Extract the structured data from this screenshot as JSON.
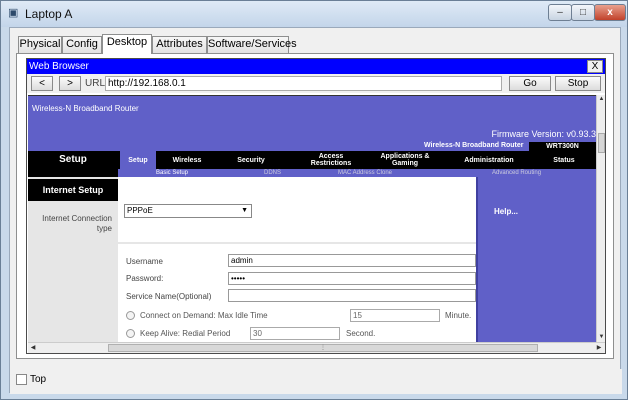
{
  "window": {
    "title": "Laptop A",
    "min_glyph": "–",
    "max_glyph": "□",
    "close_glyph": "x"
  },
  "tabs": [
    "Physical",
    "Config",
    "Desktop",
    "Attributes",
    "Software/Services"
  ],
  "active_tab": "Desktop",
  "browser": {
    "title": "Web Browser",
    "close_label": "X",
    "back_label": "<",
    "forward_label": ">",
    "url_label": "URL",
    "url_value": "http://192.168.0.1",
    "go_label": "Go",
    "stop_label": "Stop"
  },
  "router_page": {
    "banner_title": "Wireless-N Broadband Router",
    "firmware": "Firmware Version: v0.93.3",
    "product_name": "Wireless-N Broadband Router",
    "model": "WRT300N",
    "section_title": "Setup",
    "menu": [
      {
        "label": "Setup",
        "active": true
      },
      {
        "label": "Wireless",
        "active": false
      },
      {
        "label": "Security",
        "active": false
      },
      {
        "label": "Access Restrictions",
        "active": false
      },
      {
        "label": "Applications & Gaming",
        "active": false
      },
      {
        "label": "Administration",
        "active": false
      },
      {
        "label": "Status",
        "active": false
      }
    ],
    "submenu": [
      "Basic Setup",
      "DDNS",
      "MAC Address Clone",
      "Advanced Routing"
    ],
    "left_section": "Internet Setup",
    "connection_type_label": "Internet Connection type",
    "connection_type_value": "PPPoE",
    "username_label": "Username",
    "username_value": "admin",
    "password_label": "Password:",
    "password_value": "•••••",
    "service_name_label": "Service Name(Optional)",
    "service_name_value": "",
    "connect_on_demand_label": "Connect on Demand: Max Idle Time",
    "max_idle_value": "15",
    "minute_label": "Minute.",
    "keep_alive_label": "Keep Alive: Redial Period",
    "redial_value": "30",
    "second_label": "Second.",
    "help_label": "Help..."
  },
  "footer": {
    "top_label": "Top",
    "top_checked": false
  }
}
